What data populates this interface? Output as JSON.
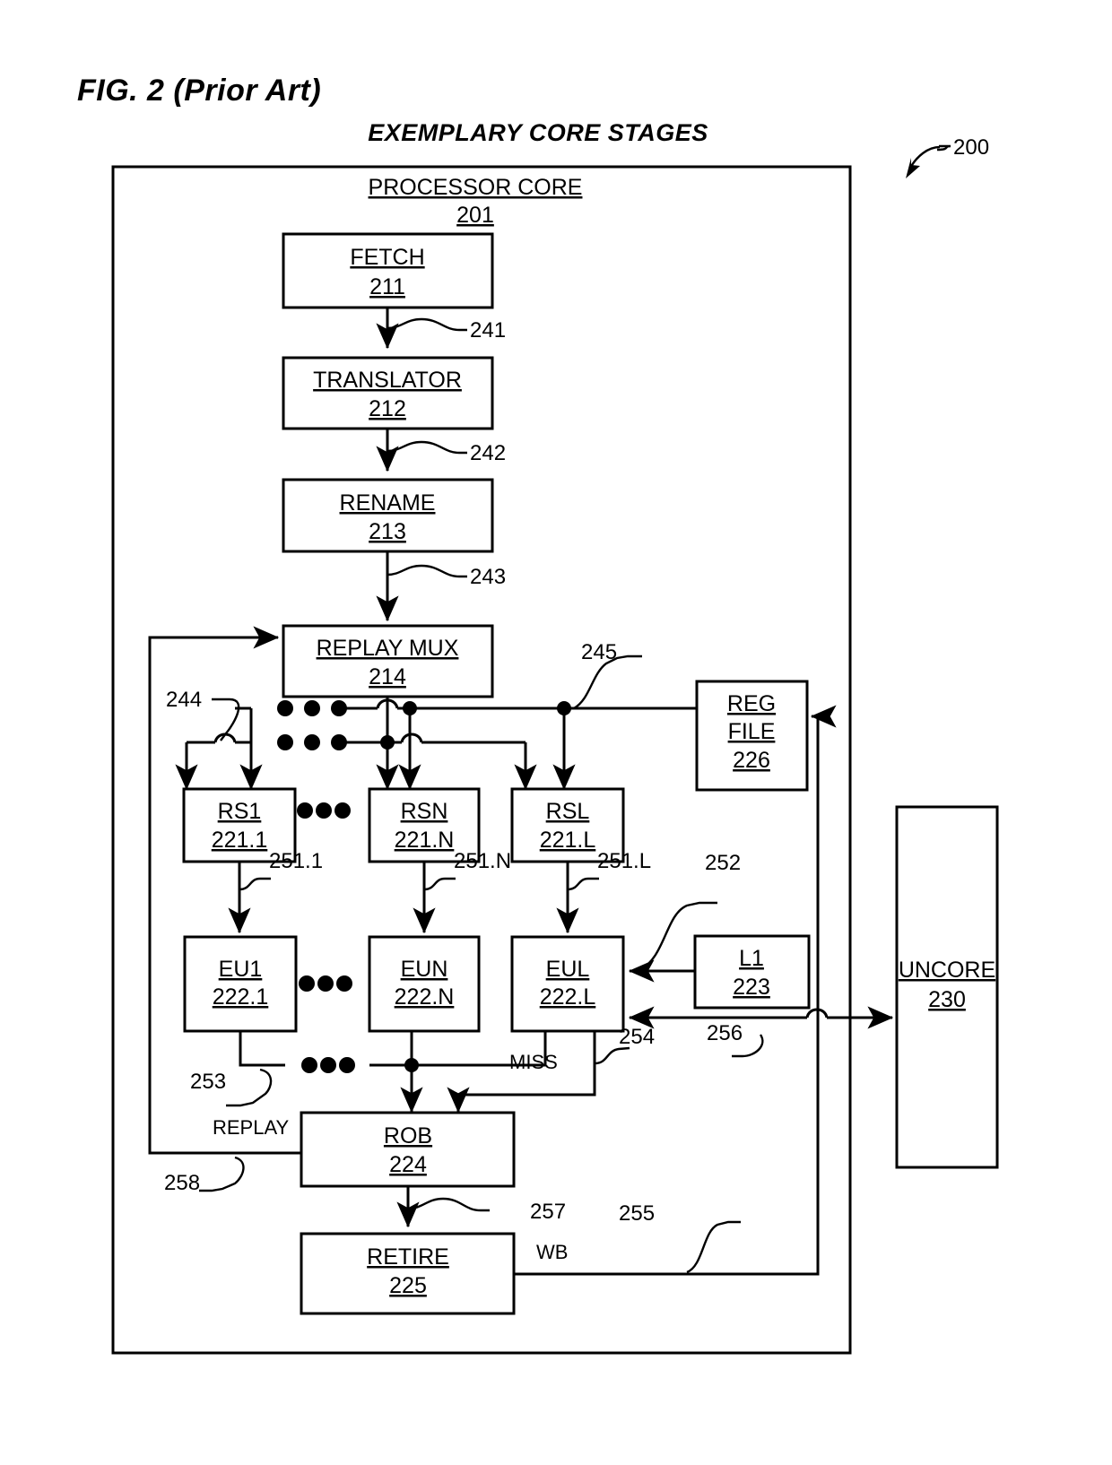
{
  "figure": {
    "label": "FIG. 2 (Prior Art)",
    "title": "EXEMPLARY CORE STAGES",
    "diagram_ref": "200"
  },
  "core": {
    "title": "PROCESSOR CORE",
    "ref": "201"
  },
  "blocks": [
    {
      "id": "fetch",
      "name": "FETCH",
      "ref": "211"
    },
    {
      "id": "translator",
      "name": "TRANSLATOR",
      "ref": "212"
    },
    {
      "id": "rename",
      "name": "RENAME",
      "ref": "213"
    },
    {
      "id": "replay_mux",
      "name": "REPLAY MUX",
      "ref": "214"
    },
    {
      "id": "reg_file",
      "name": "REG",
      "name2": "FILE",
      "ref": "226"
    },
    {
      "id": "rs1",
      "name": "RS1",
      "ref": "221.1"
    },
    {
      "id": "rsn",
      "name": "RSN",
      "ref": "221.N"
    },
    {
      "id": "rsl",
      "name": "RSL",
      "ref": "221.L"
    },
    {
      "id": "eu1",
      "name": "EU1",
      "ref": "222.1"
    },
    {
      "id": "eun",
      "name": "EUN",
      "ref": "222.N"
    },
    {
      "id": "eul",
      "name": "EUL",
      "ref": "222.L"
    },
    {
      "id": "l1",
      "name": "L1",
      "ref": "223"
    },
    {
      "id": "rob",
      "name": "ROB",
      "ref": "224"
    },
    {
      "id": "retire",
      "name": "RETIRE",
      "ref": "225"
    },
    {
      "id": "uncore",
      "name": "UNCORE",
      "ref": "230"
    }
  ],
  "signal_refs": [
    {
      "id": "s241",
      "label": "241"
    },
    {
      "id": "s242",
      "label": "242"
    },
    {
      "id": "s243",
      "label": "243"
    },
    {
      "id": "s244",
      "label": "244"
    },
    {
      "id": "s245",
      "label": "245"
    },
    {
      "id": "s251_1",
      "label": "251.1"
    },
    {
      "id": "s251_n",
      "label": "251.N"
    },
    {
      "id": "s251_l",
      "label": "251.L"
    },
    {
      "id": "s252",
      "label": "252"
    },
    {
      "id": "s253",
      "label": "253"
    },
    {
      "id": "s254",
      "label": "254"
    },
    {
      "id": "s255",
      "label": "255"
    },
    {
      "id": "s256",
      "label": "256"
    },
    {
      "id": "s257",
      "label": "257"
    },
    {
      "id": "s258",
      "label": "258"
    }
  ],
  "signal_names": {
    "miss": "MISS",
    "replay": "REPLAY",
    "wb": "WB"
  },
  "colors": {
    "line": "#000000",
    "background": "#ffffff"
  }
}
